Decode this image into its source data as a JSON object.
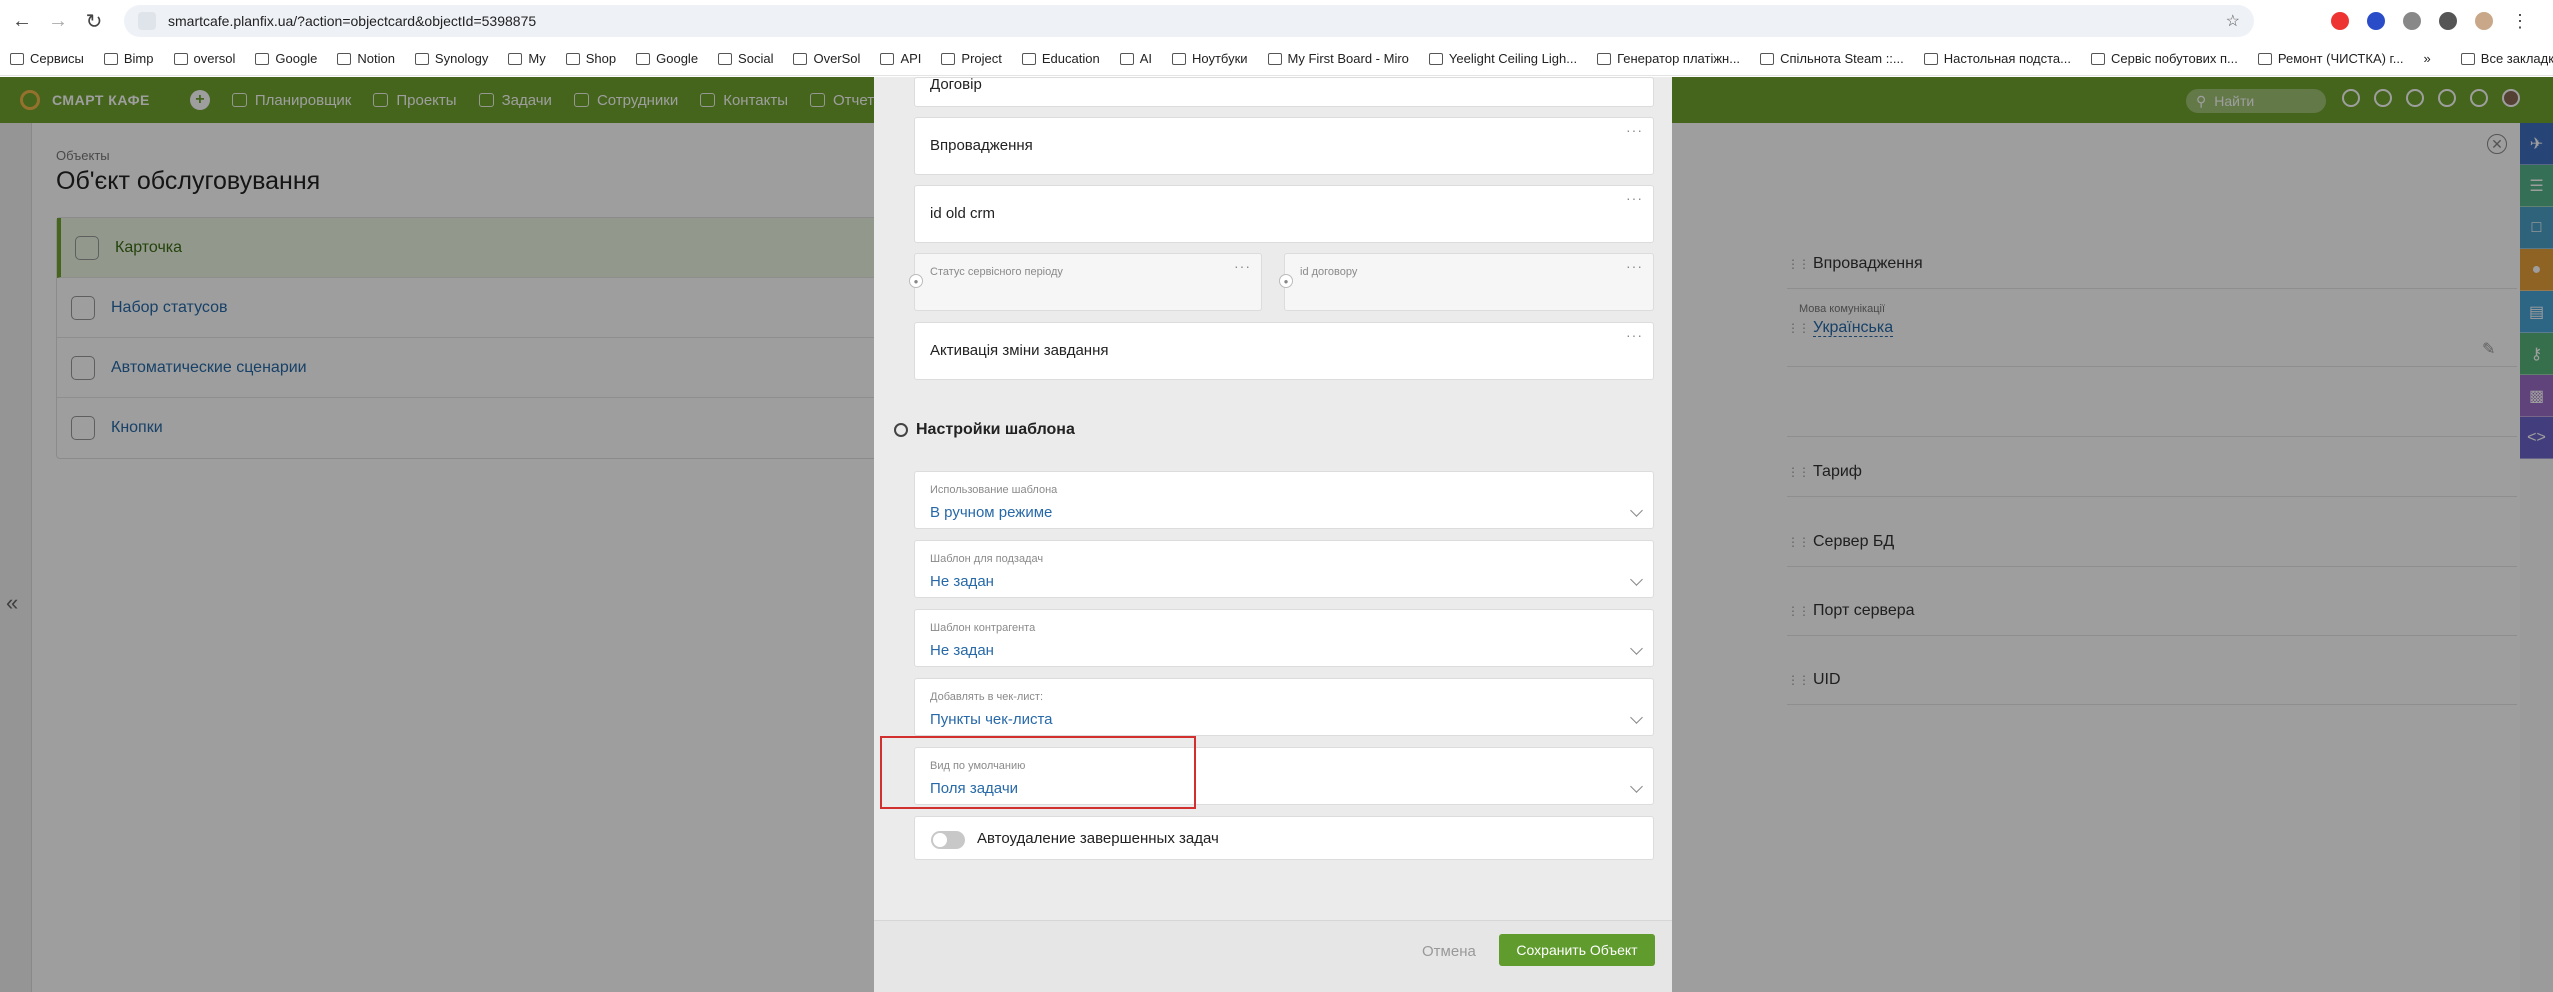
{
  "browser": {
    "url": "smartcafe.planfix.ua/?action=objectcard&objectId=5398875",
    "bookmarks": [
      "Сервисы",
      "Bimp",
      "oversol",
      "Google",
      "Notion",
      "Synology",
      "My",
      "Shop",
      "Google",
      "Social",
      "OverSol",
      "API",
      "Project",
      "Education",
      "AI",
      "Ноутбуки",
      "My First Board - Miro",
      "Yeelight Ceiling Ligh...",
      "Генератор платіжн...",
      "Спільнота Steam ::...",
      "Настольная подста...",
      "Сервіс побутових п...",
      "Ремонт (ЧИСТКА) г..."
    ],
    "bookmarks_end": "Все закладки"
  },
  "topnav": {
    "brand": "СМАРТ КАФЕ",
    "items": [
      "Планировщик",
      "Проекты",
      "Задачи",
      "Сотрудники",
      "Контакты",
      "Отчеты"
    ],
    "search_placeholder": "Найти"
  },
  "page": {
    "breadcrumb": "Объекты",
    "title": "Об'єкт обслуговування",
    "menu": [
      {
        "label": "Карточка",
        "active": true
      },
      {
        "label": "Набор статусов",
        "active": false
      },
      {
        "label": "Автоматические сценарии",
        "active": false
      },
      {
        "label": "Кнопки",
        "active": false
      }
    ],
    "right_fields": {
      "f1": "Впровадження",
      "lang_label": "Мова комунікації",
      "lang_value": "Українська",
      "f2": "Тариф",
      "f3": "Сервер БД",
      "f4": "Порт сервера",
      "f5": "UID"
    }
  },
  "modal": {
    "top_fields": {
      "contract": "Договір",
      "impl": "Впровадження",
      "old_crm": "id old crm",
      "service_status": "Статус сервісного періоду",
      "contract_id": "id договору",
      "activation": "Активація зміни завдання"
    },
    "section_title": "Настройки шаблона",
    "settings": [
      {
        "label": "Использование шаблона",
        "value": "В ручном режиме"
      },
      {
        "label": "Шаблон для подзадач",
        "value": "Не задан"
      },
      {
        "label": "Шаблон контрагента",
        "value": "Не задан"
      },
      {
        "label": "Добавлять в чек-лист:",
        "value": "Пункты чек-листа"
      },
      {
        "label": "Вид по умолчанию",
        "value": "Поля задачи"
      }
    ],
    "toggle_label": "Автоудаление завершенных задач",
    "cancel": "Отмена",
    "save": "Сохранить Объект"
  }
}
